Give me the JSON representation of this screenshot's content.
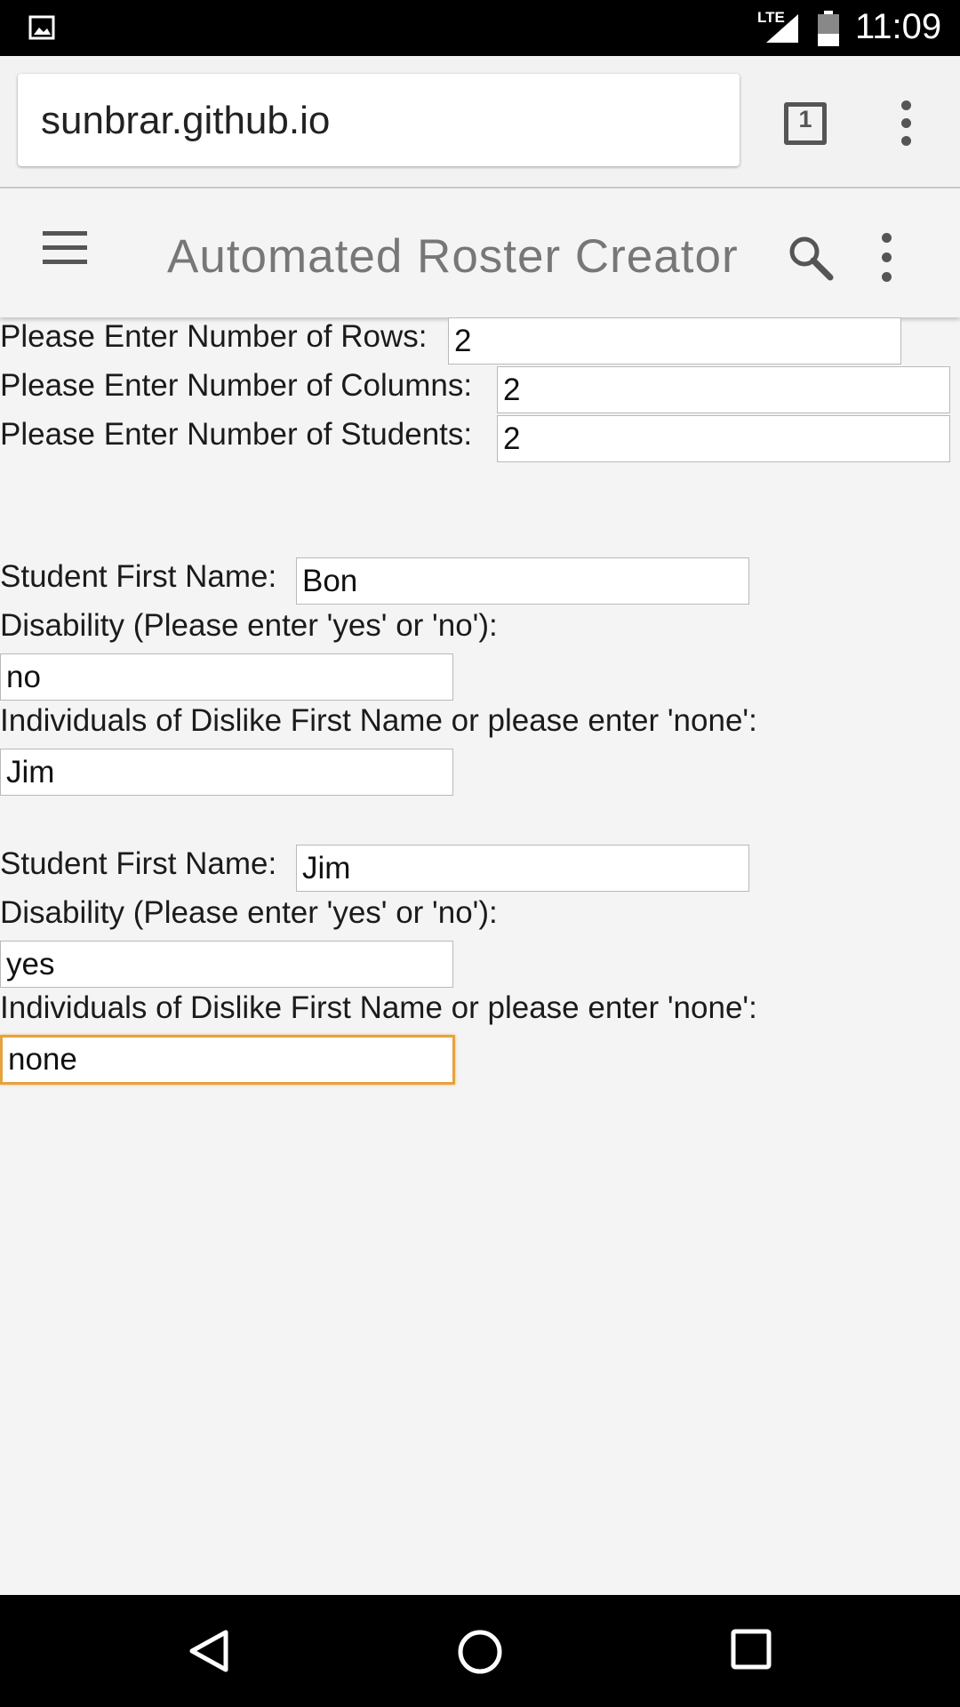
{
  "status_bar": {
    "time": "11:09",
    "network": "LTE",
    "icons": [
      "image-icon",
      "signal-icon",
      "battery-icon"
    ]
  },
  "browser": {
    "url": "sunbrar.github.io",
    "tab_count": "1"
  },
  "app_bar": {
    "title": "Automated Roster Creator"
  },
  "form": {
    "rows_label": "Please Enter Number of Rows:",
    "rows_value": "2",
    "columns_label": "Please Enter Number of Columns:",
    "columns_value": "2",
    "students_label": "Please Enter Number of Students:",
    "students_value": "2",
    "students": [
      {
        "name_label": "Student First Name:",
        "name_value": "Bon",
        "disability_label": "Disability (Please enter 'yes' or 'no'):",
        "disability_value": "no",
        "dislike_label": "Individuals of Dislike First Name or please enter 'none':",
        "dislike_value": "Jim"
      },
      {
        "name_label": "Student First Name:",
        "name_value": "Jim",
        "disability_label": "Disability (Please enter 'yes' or 'no'):",
        "disability_value": "yes",
        "dislike_label": "Individuals of Dislike First Name or please enter 'none':",
        "dislike_value": "none"
      }
    ]
  },
  "colors": {
    "focus_border": "#e6a23c",
    "background": "#f4f4f4",
    "title_text": "#777777"
  }
}
